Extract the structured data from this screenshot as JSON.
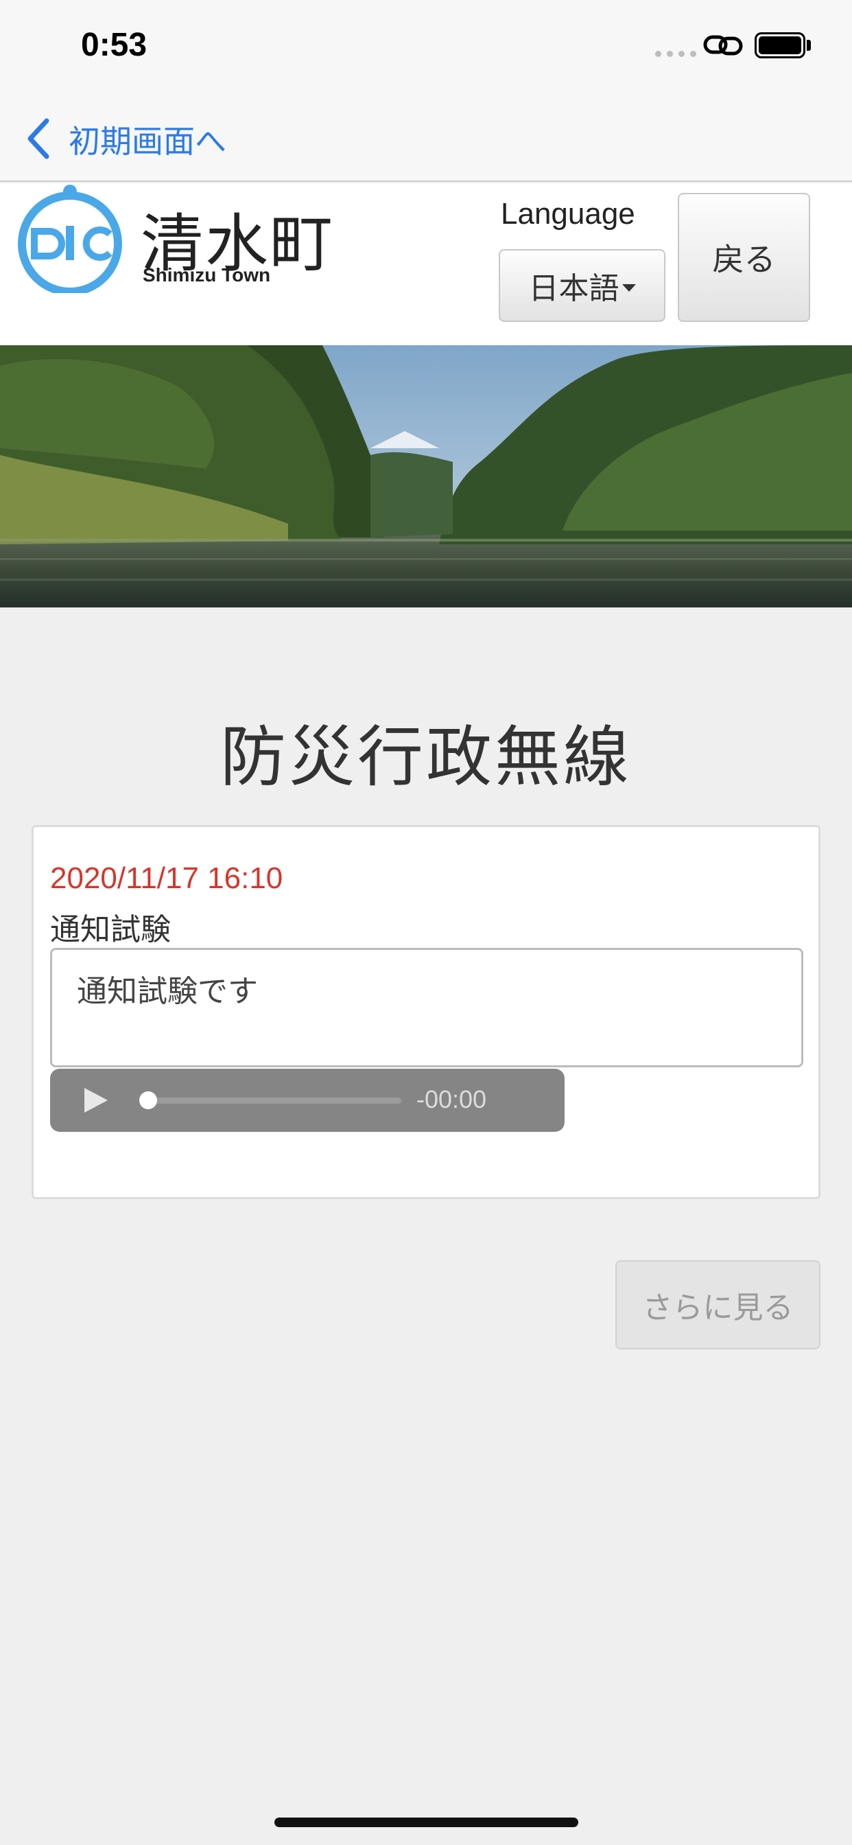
{
  "status_bar": {
    "time": "0:53"
  },
  "nav": {
    "back_label": "初期画面へ"
  },
  "header": {
    "town_name": "清水町",
    "town_name_en": "Shimizu Town",
    "language_label": "Language",
    "language_value": "日本語",
    "back_button": "戻る"
  },
  "page": {
    "title": "防災行政無線"
  },
  "notice": {
    "date": "2020/11/17 16:10",
    "title": "通知試験",
    "body": "通知試験です",
    "audio_time": "-00:00",
    "audio_progress": 0
  },
  "more_button": "さらに見る",
  "colors": {
    "accent": "#2c7be5",
    "date_red": "#d7352b",
    "logo_blue": "#4aa8e8",
    "background": "#efefef"
  }
}
